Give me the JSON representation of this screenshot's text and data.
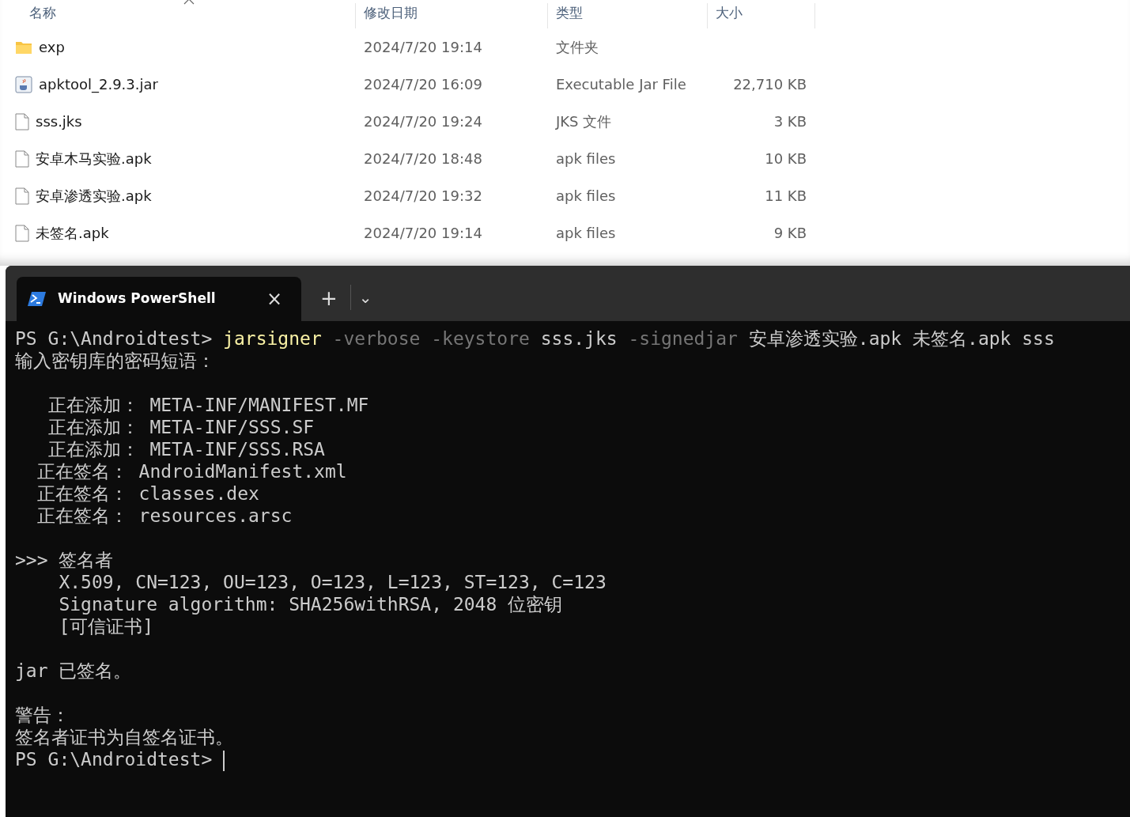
{
  "explorer": {
    "columns": [
      {
        "label": "名称",
        "sort_indicator": true
      },
      {
        "label": "修改日期"
      },
      {
        "label": "类型"
      },
      {
        "label": "大小"
      }
    ],
    "rows": [
      {
        "kind": "folder",
        "name": "exp",
        "modified": "2024/7/20 19:14",
        "type": "文件夹"
      },
      {
        "kind": "jar",
        "name": "apktool_2.9.3.jar",
        "modified": "2024/7/20 16:09",
        "type": "Executable Jar File",
        "size": "22,710 KB"
      },
      {
        "kind": "file",
        "name": "sss.jks",
        "modified": "2024/7/20 19:24",
        "type": "JKS 文件",
        "size": "3 KB"
      },
      {
        "kind": "file",
        "name": "安卓木马实验.apk",
        "modified": "2024/7/20 18:48",
        "type": "apk files",
        "size": "10 KB"
      },
      {
        "kind": "file",
        "name": "安卓渗透实验.apk",
        "modified": "2024/7/20 19:32",
        "type": "apk files",
        "size": "11 KB"
      },
      {
        "kind": "file",
        "name": "未签名.apk",
        "modified": "2024/7/20 19:14",
        "type": "apk files",
        "size": "9 KB"
      }
    ]
  },
  "terminal": {
    "tabs": [
      {
        "title": "Windows PowerShell",
        "selected": true,
        "close": "×"
      }
    ],
    "new_tab": "+",
    "dropdown": "⌄",
    "lines": [
      {
        "gap_before": false,
        "segments": [
          {
            "kind": "plain",
            "text": "PS G:\\Androidtest> "
          },
          {
            "kind": "command",
            "text": "jarsigner"
          },
          {
            "kind": "parameter",
            "text": " -verbose -keystore"
          },
          {
            "kind": "plain",
            "text": " sss.jks "
          },
          {
            "kind": "parameter",
            "text": "-signedjar"
          },
          {
            "kind": "plain",
            "text": " 安卓渗透实验.apk 未签名.apk sss"
          }
        ]
      },
      {
        "gap_before": false,
        "segments": [
          {
            "kind": "plain",
            "text": "输入密钥库的密码短语："
          }
        ]
      },
      {
        "gap_before": true,
        "segments": [
          {
            "kind": "plain",
            "text": "   正在添加： META-INF/MANIFEST.MF"
          }
        ]
      },
      {
        "gap_before": false,
        "segments": [
          {
            "kind": "plain",
            "text": "   正在添加： META-INF/SSS.SF"
          }
        ]
      },
      {
        "gap_before": false,
        "segments": [
          {
            "kind": "plain",
            "text": "   正在添加： META-INF/SSS.RSA"
          }
        ]
      },
      {
        "gap_before": false,
        "segments": [
          {
            "kind": "plain",
            "text": "  正在签名： AndroidManifest.xml"
          }
        ]
      },
      {
        "gap_before": false,
        "segments": [
          {
            "kind": "plain",
            "text": "  正在签名： classes.dex"
          }
        ]
      },
      {
        "gap_before": false,
        "segments": [
          {
            "kind": "plain",
            "text": "  正在签名： resources.arsc"
          }
        ]
      },
      {
        "gap_before": true,
        "segments": [
          {
            "kind": "plain",
            "text": ">>> 签名者"
          }
        ]
      },
      {
        "gap_before": false,
        "segments": [
          {
            "kind": "plain",
            "text": "    X.509, CN=123, OU=123, O=123, L=123, ST=123, C=123"
          }
        ]
      },
      {
        "gap_before": false,
        "segments": [
          {
            "kind": "plain",
            "text": "    Signature algorithm: SHA256withRSA, 2048 位密钥"
          }
        ]
      },
      {
        "gap_before": false,
        "segments": [
          {
            "kind": "plain",
            "text": "    [可信证书]"
          }
        ]
      },
      {
        "gap_before": true,
        "segments": [
          {
            "kind": "plain",
            "text": "jar 已签名。"
          }
        ]
      },
      {
        "gap_before": true,
        "segments": [
          {
            "kind": "plain",
            "text": "警告："
          }
        ]
      },
      {
        "gap_before": false,
        "segments": [
          {
            "kind": "plain",
            "text": "签名者证书为自签名证书。"
          }
        ]
      },
      {
        "gap_before": false,
        "cursor": true,
        "segments": [
          {
            "kind": "plain",
            "text": "PS G:\\Androidtest> "
          }
        ]
      }
    ]
  }
}
